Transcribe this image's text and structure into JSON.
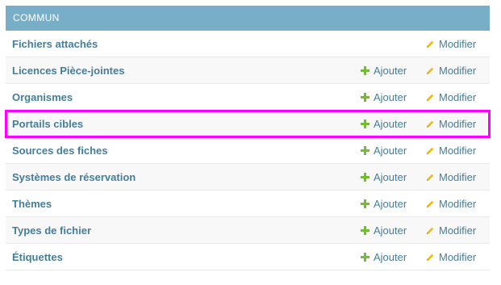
{
  "module": {
    "caption": "COMMUN"
  },
  "colors": {
    "header_bg": "#79aec8",
    "link": "#447e9b",
    "add_icon": "#70bf2b",
    "change_icon": "#efb80b",
    "highlight": "#ff00ff"
  },
  "rows": [
    {
      "name": "Fichiers attachés",
      "add": "",
      "change": "Modifier"
    },
    {
      "name": "Licences Pièce-jointes",
      "add": "Ajouter",
      "change": "Modifier"
    },
    {
      "name": "Organismes",
      "add": "Ajouter",
      "change": "Modifier"
    },
    {
      "name": "Portails cibles",
      "add": "Ajouter",
      "change": "Modifier"
    },
    {
      "name": "Sources des fiches",
      "add": "Ajouter",
      "change": "Modifier"
    },
    {
      "name": "Systèmes de réservation",
      "add": "Ajouter",
      "change": "Modifier"
    },
    {
      "name": "Thèmes",
      "add": "Ajouter",
      "change": "Modifier"
    },
    {
      "name": "Types de fichier",
      "add": "Ajouter",
      "change": "Modifier"
    },
    {
      "name": "Étiquettes",
      "add": "Ajouter",
      "change": "Modifier"
    }
  ]
}
